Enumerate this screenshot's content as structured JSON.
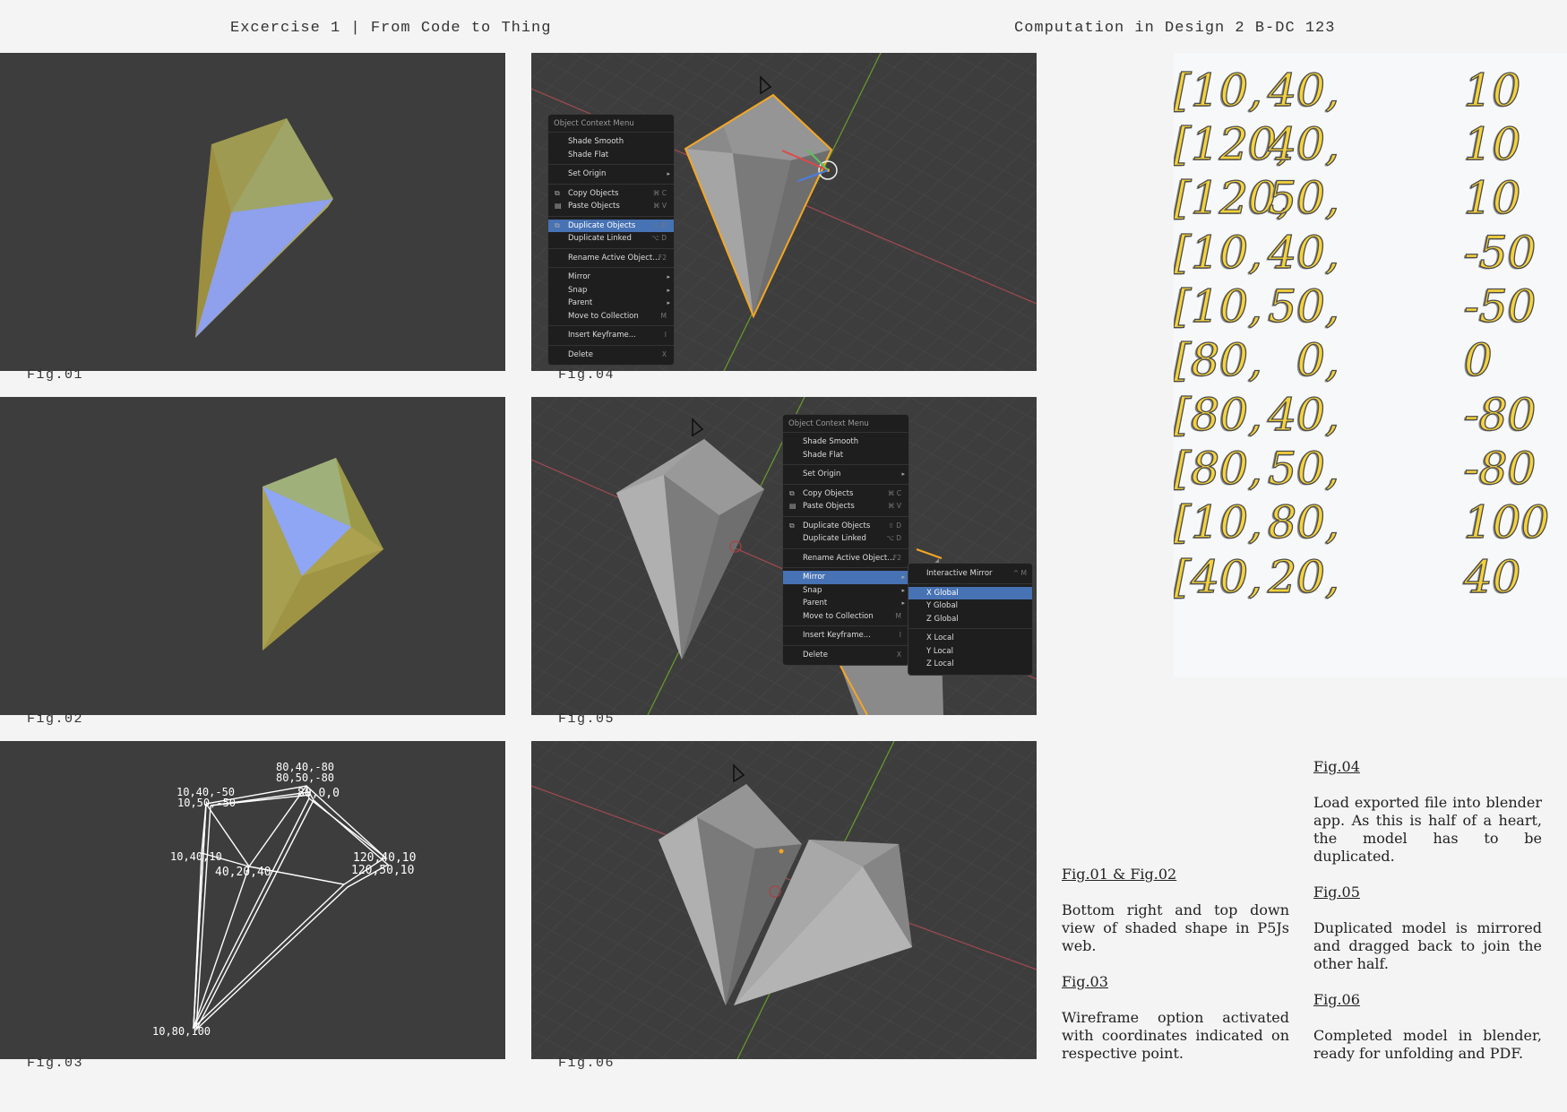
{
  "header": {
    "left": "Excercise 1 | From Code to Thing",
    "right": "Computation in Design 2 B-DC 123"
  },
  "figures": {
    "fig01": "Fig.01",
    "fig02": "Fig.02",
    "fig03": "Fig.03",
    "fig04": "Fig.04",
    "fig05": "Fig.05",
    "fig06": "Fig.06"
  },
  "wireframe_labels": [
    "80,40,-80",
    "80,50,-80",
    "10,40,-50",
    "10,50,-50",
    "80,0,0",
    "10,40,10",
    "40,20,40",
    "120,40,10",
    "120,50,10",
    "10,80,100"
  ],
  "context_menu": {
    "title": "Object Context Menu",
    "items": [
      {
        "label": "Shade Smooth",
        "shortcut": ""
      },
      {
        "label": "Shade Flat",
        "shortcut": ""
      },
      {
        "label": "Set Origin",
        "shortcut": "▸"
      },
      {
        "label": "Copy Objects",
        "shortcut": "⌘ C"
      },
      {
        "label": "Paste Objects",
        "shortcut": "⌘ V"
      },
      {
        "label": "Duplicate Objects",
        "shortcut": "⇧ D"
      },
      {
        "label": "Duplicate Linked",
        "shortcut": "⌥ D"
      },
      {
        "label": "Rename Active Object...",
        "shortcut": "F2"
      },
      {
        "label": "Mirror",
        "shortcut": "▸"
      },
      {
        "label": "Snap",
        "shortcut": "▸"
      },
      {
        "label": "Parent",
        "shortcut": "▸"
      },
      {
        "label": "Move to Collection",
        "shortcut": "M"
      },
      {
        "label": "Insert Keyframe...",
        "shortcut": "I"
      },
      {
        "label": "Delete",
        "shortcut": "X"
      }
    ]
  },
  "mirror_submenu": {
    "items": [
      {
        "label": "Interactive Mirror",
        "shortcut": "^ M"
      },
      {
        "label": "X Global",
        "shortcut": ""
      },
      {
        "label": "Y Global",
        "shortcut": ""
      },
      {
        "label": "Z Global",
        "shortcut": ""
      },
      {
        "label": "X Local",
        "shortcut": ""
      },
      {
        "label": "Y Local",
        "shortcut": ""
      },
      {
        "label": "Z Local",
        "shortcut": ""
      }
    ]
  },
  "coordinates": [
    [
      "[10,",
      "40,",
      "10"
    ],
    [
      "[120,",
      "40,",
      "10"
    ],
    [
      "[120,",
      "50,",
      "10"
    ],
    [
      "[10,",
      "40,",
      "-50"
    ],
    [
      "[10,",
      "50,",
      "-50"
    ],
    [
      "[80,",
      "0,",
      "0"
    ],
    [
      "[80,",
      "40,",
      "-80"
    ],
    [
      "[80,",
      "50,",
      "-80"
    ],
    [
      "[10,",
      "80,",
      "100"
    ],
    [
      "[40,",
      "20,",
      "40"
    ]
  ],
  "notes": {
    "fig0102": {
      "title": "Fig.01 & Fig.02",
      "body": "Bottom right and top down view of shaded shape in P5Js web."
    },
    "fig03": {
      "title": "Fig.03",
      "body": "Wireframe option activated with coordinates indicated on respective point."
    },
    "fig04": {
      "title": "Fig.04",
      "body": "Load exported file into blender app. As this is half of a heart, the model has to be duplicated."
    },
    "fig05": {
      "title": "Fig.05",
      "body": "Duplicated model is mirrored and dragged back to join the other half."
    },
    "fig06": {
      "title": "Fig.06",
      "body": "Completed model in blender, ready for unfolding and PDF."
    }
  },
  "colors": {
    "viewport": "#3d3d3d",
    "menu_highlight": "#4772b3",
    "selection_outline": "#f5a623",
    "coord_fill": "#f5d23a"
  }
}
